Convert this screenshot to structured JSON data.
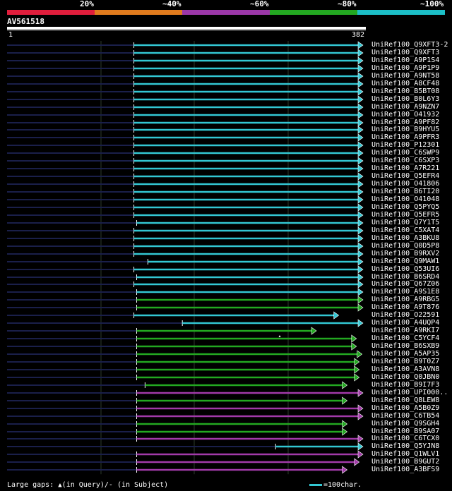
{
  "legend": [
    {
      "label": "20%",
      "color": "#e01e3c"
    },
    {
      "label": "~40%",
      "color": "#e07b1e"
    },
    {
      "label": "~60%",
      "color": "#9b37a8"
    },
    {
      "label": "~80%",
      "color": "#23a821"
    },
    {
      "label": "~100%",
      "color": "#1cbfc7"
    }
  ],
  "query": {
    "name": "AV561518",
    "start": "1",
    "end": "382",
    "length": 382
  },
  "hits": [
    {
      "name": "UniRef100_Q9XFT3-2",
      "qs": 137,
      "qe": 382,
      "color": "#33c7d3"
    },
    {
      "name": "UniRef100_Q9XFT3",
      "qs": 137,
      "qe": 382,
      "color": "#33c7d3"
    },
    {
      "name": "UniRef100_A9P1S4",
      "qs": 137,
      "qe": 382,
      "color": "#33c7d3"
    },
    {
      "name": "UniRef100_A9P1P9",
      "qs": 137,
      "qe": 382,
      "color": "#33c7d3"
    },
    {
      "name": "UniRef100_A9NT58",
      "qs": 137,
      "qe": 382,
      "color": "#33c7d3"
    },
    {
      "name": "UniRef100_A8CF48",
      "qs": 137,
      "qe": 382,
      "color": "#33c7d3"
    },
    {
      "name": "UniRef100_B5BT08",
      "qs": 137,
      "qe": 382,
      "color": "#33c7d3"
    },
    {
      "name": "UniRef100_B0L6Y3",
      "qs": 137,
      "qe": 382,
      "color": "#33c7d3"
    },
    {
      "name": "UniRef100_A9NZN7",
      "qs": 137,
      "qe": 382,
      "color": "#33c7d3"
    },
    {
      "name": "UniRef100_O41932",
      "qs": 137,
      "qe": 382,
      "color": "#33c7d3"
    },
    {
      "name": "UniRef100_A9PF82",
      "qs": 137,
      "qe": 382,
      "color": "#33c7d3"
    },
    {
      "name": "UniRef100_B9HYU5",
      "qs": 137,
      "qe": 382,
      "color": "#33c7d3"
    },
    {
      "name": "UniRef100_A9PFR3",
      "qs": 137,
      "qe": 382,
      "color": "#33c7d3"
    },
    {
      "name": "UniRef100_P12301",
      "qs": 137,
      "qe": 382,
      "color": "#33c7d3"
    },
    {
      "name": "UniRef100_C6SWP9",
      "qs": 137,
      "qe": 382,
      "color": "#33c7d3"
    },
    {
      "name": "UniRef100_C6SXP3",
      "qs": 137,
      "qe": 382,
      "color": "#33c7d3"
    },
    {
      "name": "UniRef100_A7R221",
      "qs": 137,
      "qe": 382,
      "color": "#33c7d3"
    },
    {
      "name": "UniRef100_Q5EFR4",
      "qs": 137,
      "qe": 382,
      "color": "#33c7d3"
    },
    {
      "name": "UniRef100_O41806",
      "qs": 137,
      "qe": 382,
      "color": "#33c7d3"
    },
    {
      "name": "UniRef100_B6TI20",
      "qs": 137,
      "qe": 382,
      "color": "#33c7d3"
    },
    {
      "name": "UniRef100_O41048",
      "qs": 137,
      "qe": 382,
      "color": "#33c7d3"
    },
    {
      "name": "UniRef100_Q5PYQ5",
      "qs": 137,
      "qe": 382,
      "color": "#33c7d3"
    },
    {
      "name": "UniRef100_Q5EFR5",
      "qs": 137,
      "qe": 382,
      "color": "#33c7d3"
    },
    {
      "name": "UniRef100_Q7Y1T5",
      "qs": 140,
      "qe": 382,
      "color": "#33c7d3"
    },
    {
      "name": "UniRef100_C5XAT4",
      "qs": 137,
      "qe": 382,
      "color": "#33c7d3"
    },
    {
      "name": "UniRef100_A3BKU8",
      "qs": 137,
      "qe": 382,
      "color": "#33c7d3"
    },
    {
      "name": "UniRef100_Q0D5P8",
      "qs": 137,
      "qe": 382,
      "color": "#33c7d3"
    },
    {
      "name": "UniRef100_B9RXV2",
      "qs": 137,
      "qe": 382,
      "color": "#33c7d3"
    },
    {
      "name": "UniRef100_Q9MAW1",
      "qs": 152,
      "qe": 382,
      "color": "#33c7d3"
    },
    {
      "name": "UniRef100_Q53UI6",
      "qs": 137,
      "qe": 382,
      "color": "#33c7d3"
    },
    {
      "name": "UniRef100_B6SRD4",
      "qs": 140,
      "qe": 382,
      "color": "#33c7d3"
    },
    {
      "name": "UniRef100_Q67Z06",
      "qs": 137,
      "qe": 382,
      "color": "#33c7d3"
    },
    {
      "name": "UniRef100_A9S1E8",
      "qs": 140,
      "qe": 382,
      "color": "#33c7d3"
    },
    {
      "name": "UniRef100_A9RBG5",
      "qs": 140,
      "qe": 382,
      "color": "#23a821"
    },
    {
      "name": "UniRef100_A9T876",
      "qs": 140,
      "qe": 382,
      "color": "#23a821"
    },
    {
      "name": "UniRef100_O22591",
      "qs": 137,
      "qe": 356,
      "color": "#33c7d3"
    },
    {
      "name": "UniRef100_A4UQP4",
      "qs": 189,
      "qe": 382,
      "color": "#33c7d3"
    },
    {
      "name": "UniRef100_A9RKI7",
      "qs": 140,
      "qe": 332,
      "color": "#23a821",
      "gap_query": true
    },
    {
      "name": "UniRef100_C5YCF4",
      "qs": 140,
      "qe": 375,
      "color": "#23a821"
    },
    {
      "name": "UniRef100_B6SXB9",
      "qs": 140,
      "qe": 375,
      "color": "#23a821"
    },
    {
      "name": "UniRef100_A5AP35",
      "qs": 140,
      "qe": 381,
      "color": "#23a821"
    },
    {
      "name": "UniRef100_B9T0Z7",
      "qs": 140,
      "qe": 378,
      "color": "#23a821"
    },
    {
      "name": "UniRef100_A3AVN8",
      "qs": 140,
      "qe": 378,
      "color": "#23a821"
    },
    {
      "name": "UniRef100_Q0JBN0",
      "qs": 140,
      "qe": 378,
      "color": "#23a821"
    },
    {
      "name": "UniRef100_B9I7F3",
      "qs": 149,
      "qe": 365,
      "color": "#23a821"
    },
    {
      "name": "UniRef100_UPI000..",
      "qs": 140,
      "qe": 382,
      "color": "#a23aa9"
    },
    {
      "name": "UniRef100_Q8LEW8",
      "qs": 140,
      "qe": 365,
      "color": "#23a821"
    },
    {
      "name": "UniRef100_A5B0Z9",
      "qs": 140,
      "qe": 382,
      "color": "#a23aa9"
    },
    {
      "name": "UniRef100_C6TB54",
      "qs": 140,
      "qe": 382,
      "color": "#a23aa9"
    },
    {
      "name": "UniRef100_Q9SGH4",
      "qs": 140,
      "qe": 365,
      "color": "#23a821"
    },
    {
      "name": "UniRef100_B9SA07",
      "qs": 140,
      "qe": 365,
      "color": "#23a821"
    },
    {
      "name": "UniRef100_C6TCX0",
      "qs": 140,
      "qe": 382,
      "color": "#a23aa9"
    },
    {
      "name": "UniRef100_Q5YJN8",
      "qs": 289,
      "qe": 382,
      "color": "#33c7d3"
    },
    {
      "name": "UniRef100_Q1WLV1",
      "qs": 140,
      "qe": 382,
      "color": "#a23aa9"
    },
    {
      "name": "UniRef100_B9GUT2",
      "qs": 140,
      "qe": 378,
      "color": "#a23aa9"
    },
    {
      "name": "UniRef100_A3BFS9",
      "qs": 140,
      "qe": 365,
      "color": "#a23aa9"
    }
  ],
  "footer": {
    "gaps_text": "Large gaps: ",
    "query_gap_text": "(in Query)/",
    "subject_gap_symbol": "-",
    "subject_gap_text": " (in Subject)",
    "scale_text": "=100char."
  }
}
